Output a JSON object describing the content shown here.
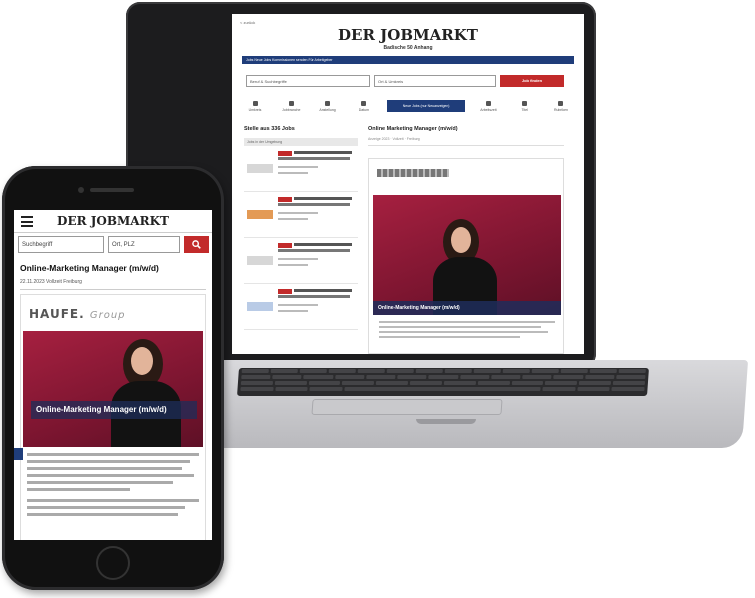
{
  "laptop": {
    "top_link": "< zurück",
    "logo": "DER JOBMARKT",
    "subtitle": "Badische 50 Anhang",
    "nav": "Jobs   Neue Jobs   Kommissionen senden   Für Arbeitgeber",
    "search_what": "Beruf & Suchbegriffe",
    "search_where": "Ort & Umkreis",
    "search_button": "Job finden",
    "filters": [
      "Umkreis",
      "Jobbranche",
      "Anstellung",
      "Datum",
      "Arbeitszeit",
      "Titel",
      "Rubriken"
    ],
    "sort_label": "Neue Jobs (nur Neuanzeigen)",
    "result_count": "Stelle aus 336 Jobs",
    "list_header": "Jobs in der Umgebung",
    "job_title": "Online Marketing Manager (m/w/d)",
    "job_meta": "Anzeige 2023 · Vollzeit · Freiburg",
    "card_caption": "Online-Marketing Manager (m/w/d)"
  },
  "phone": {
    "logo": "DER JOBMARKT",
    "search_what": "Suchbegriff",
    "search_where": "Ort, PLZ",
    "job_title": "Online-Marketing Manager (m/w/d)",
    "job_meta": "22.11.2023   Vollzeit   Freiburg",
    "card_logo": "HAUFE.",
    "card_logo_tagline": "Group",
    "card_caption": "Online-Marketing Manager (m/w/d)"
  },
  "colors": {
    "brand_blue": "#1f3d7a",
    "accent_red": "#c22a2a"
  }
}
